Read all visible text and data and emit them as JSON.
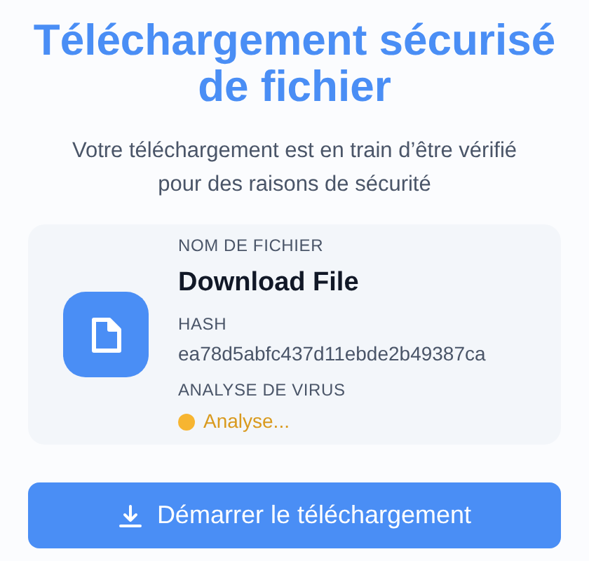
{
  "title": "Téléchargement sécurisé de fichier",
  "subtitle": "Votre téléchargement est en train d’être vérifié pour des raisons de sécurité",
  "file": {
    "name_label": "NOM DE FICHIER",
    "name": "Download File",
    "hash_label": "HASH",
    "hash": "ea78d5abfc437d11ebde2b49387ca",
    "scan_label": "ANALYSE DE VIRUS",
    "scan_status": {
      "kind": "scanning",
      "text": "Analyse..."
    }
  },
  "button": {
    "label": "Démarrer le téléchargement"
  }
}
